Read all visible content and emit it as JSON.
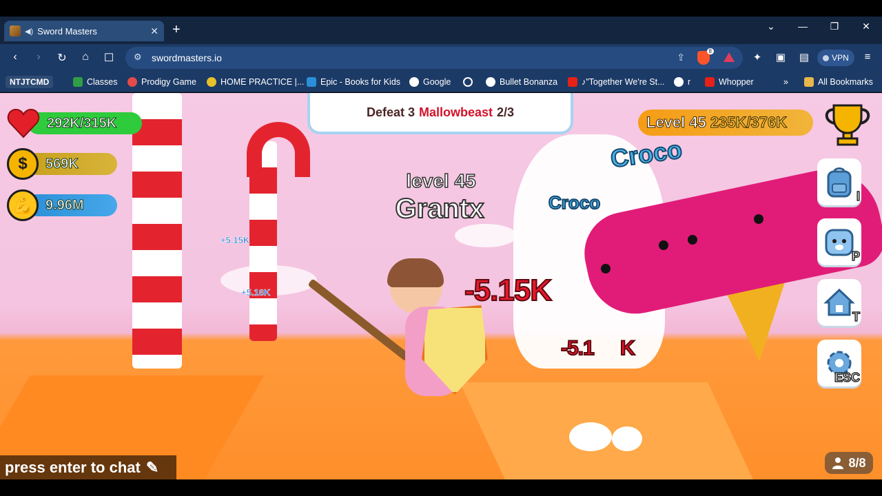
{
  "browser": {
    "tab": {
      "title": "Sword Masters"
    },
    "address_bar": {
      "url": "swordmasters.io"
    },
    "vpn_label": "VPN",
    "brave_badge": "8",
    "bookmarks": [
      {
        "label": "NTJTCMD",
        "icon": "none"
      },
      {
        "label": "Classes",
        "icon": "classes-icon"
      },
      {
        "label": "Prodigy Game",
        "icon": "prodigy-icon"
      },
      {
        "label": "HOME PRACTICE |...",
        "icon": "home-practice-icon"
      },
      {
        "label": "Epic - Books for Kids",
        "icon": "epic-icon"
      },
      {
        "label": "Google",
        "icon": "google-icon"
      },
      {
        "label": "",
        "icon": "history-icon"
      },
      {
        "label": "Bullet Bonanza",
        "icon": "globe-icon"
      },
      {
        "label": "♪\"Together We're St...",
        "icon": "youtube-icon"
      },
      {
        "label": "r",
        "icon": "globe-icon"
      },
      {
        "label": "Whopper",
        "icon": "youtube-icon"
      }
    ],
    "bookmarks_overflow": "»",
    "all_bookmarks": "All Bookmarks"
  },
  "game": {
    "health": "292K/315K",
    "coins": "569K",
    "strength": "9.96M",
    "quest": {
      "prefix": "Defeat 3",
      "target": "Mallowbeast",
      "progress": "2/3"
    },
    "level_label": "Level 45",
    "xp": "235K/376K",
    "player": {
      "level_text": "level 45",
      "name": "Grantx"
    },
    "mobs": [
      "Croco",
      "Croco"
    ],
    "damage": [
      "-5.15K",
      "-5.1",
      "K"
    ],
    "small_damage": [
      "+5.15K",
      "+5.16K"
    ],
    "side_buttons": [
      {
        "name": "backpack",
        "key": "I"
      },
      {
        "name": "pets",
        "key": "P"
      },
      {
        "name": "home",
        "key": "T"
      },
      {
        "name": "settings",
        "key": "ESC"
      }
    ],
    "chat_prompt": "press enter to chat",
    "players_count": "8/8"
  },
  "colors": {
    "health_bar": "#2ecc3c",
    "coin_bar": "#c8a01c",
    "strength_bar": "#2a8fd6",
    "accent_red": "#d4122a"
  }
}
